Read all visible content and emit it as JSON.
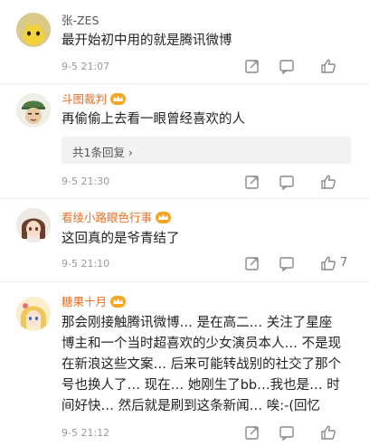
{
  "comments": [
    {
      "user": "张-ZES",
      "text": "最开始初中用的就是腾讯微博",
      "time": "9-5 21:07",
      "likes": ""
    },
    {
      "user": "斗图裁判",
      "text": "再偷偷上去看一眼曾经喜欢的人",
      "replies_label": "共1条回复 ›",
      "time": "9-5 21:30",
      "likes": ""
    },
    {
      "user": "看绫小路眼色行事",
      "text": "这回真的是爷青结了",
      "time": "9-5 21:10",
      "likes": "7"
    },
    {
      "user": "糖果十月",
      "text_lines": [
        "那会刚接触腾讯微博… 是在高二… 关注了星座",
        "博主和一个当时超喜欢的少女演员本人… 不是现",
        "在新浪这些文案… 后来可能转战别的社交了那个",
        "号也换人了… 现在… 她刚生了bb…我也是… 时",
        "间好快… 然后就是刷到这条新闻… 唉:-(回忆"
      ],
      "time": "9-5 21:12",
      "likes": ""
    }
  ],
  "icons": {
    "share": "share-icon",
    "reply": "comment-icon",
    "like": "thumbs-up-icon",
    "vip": "vip-crown-icon"
  },
  "colors": {
    "vip_name": "#e86f26",
    "plain_name": "#555555",
    "meta": "#999999",
    "icon": "#8a8a8a"
  }
}
